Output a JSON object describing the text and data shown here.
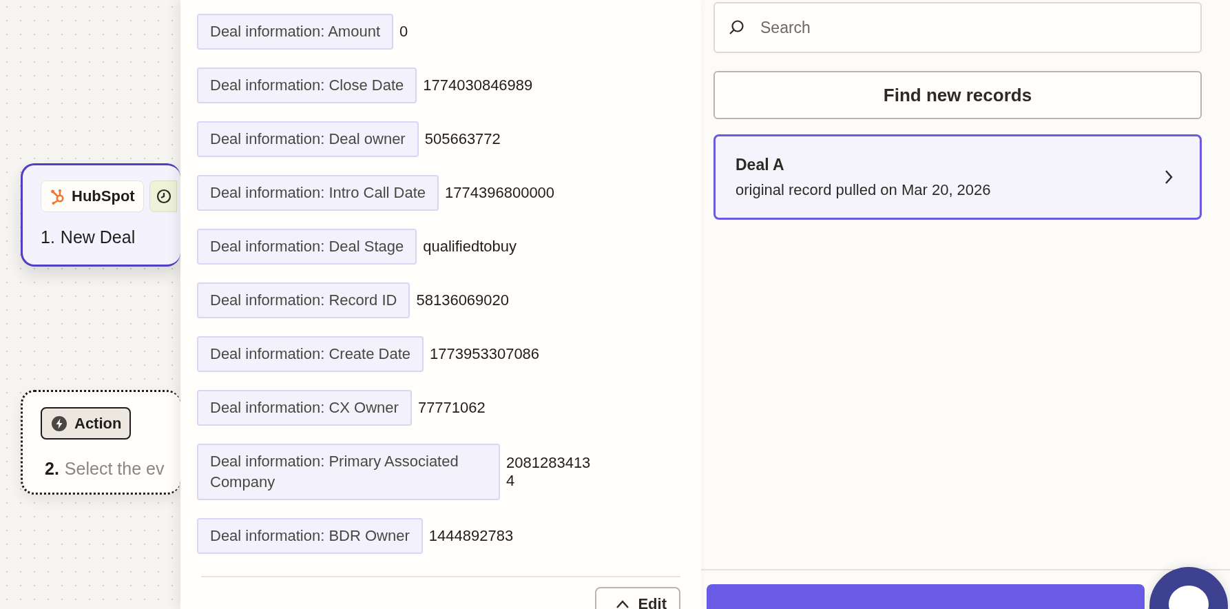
{
  "canvas": {
    "steps": [
      {
        "kind": "trigger",
        "app": "HubSpot",
        "number": "1.",
        "title": "New Deal",
        "selected": true
      },
      {
        "kind": "action",
        "badge": "Action",
        "number": "2.",
        "title": "Select the ev",
        "selected": false
      }
    ]
  },
  "fields": [
    {
      "label": "Deal information: Amount",
      "value": "0"
    },
    {
      "label": "Deal information: Close Date",
      "value": "1774030846989"
    },
    {
      "label": "Deal information: Deal owner",
      "value": "505663772"
    },
    {
      "label": "Deal information: Intro Call Date",
      "value": "1774396800000"
    },
    {
      "label": "Deal information: Deal Stage",
      "value": "qualifiedtobuy"
    },
    {
      "label": "Deal information: Record ID",
      "value": "58136069020"
    },
    {
      "label": "Deal information: Create Date",
      "value": "1773953307086"
    },
    {
      "label": "Deal information: CX Owner",
      "value": "77771062"
    },
    {
      "label": "Deal information: Primary Associated Company",
      "value": "20812834134"
    },
    {
      "label": "Deal information: BDR Owner",
      "value": "1444892783"
    }
  ],
  "edit_button": {
    "label": "Edit"
  },
  "search": {
    "placeholder": "Search"
  },
  "find_button": {
    "label": "Find new records"
  },
  "records": [
    {
      "title": "Deal A",
      "subtitle": "original record pulled on Mar 20, 2026",
      "selected": true
    }
  ]
}
